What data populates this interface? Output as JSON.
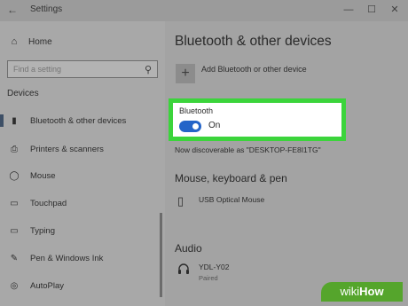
{
  "window": {
    "title": "Settings",
    "back_glyph": "←",
    "controls": {
      "minimize": "—",
      "maximize": "☐",
      "close": "✕"
    }
  },
  "sidebar": {
    "home_label": "Home",
    "search_placeholder": "Find a setting",
    "section_title": "Devices",
    "items": [
      {
        "label": "Bluetooth & other devices",
        "icon": "bluetooth-icon",
        "glyph": "▮",
        "active": true
      },
      {
        "label": "Printers & scanners",
        "icon": "printer-icon",
        "glyph": "⎙"
      },
      {
        "label": "Mouse",
        "icon": "mouse-icon",
        "glyph": "◯"
      },
      {
        "label": "Touchpad",
        "icon": "touchpad-icon",
        "glyph": "▭"
      },
      {
        "label": "Typing",
        "icon": "keyboard-icon",
        "glyph": "▭"
      },
      {
        "label": "Pen & Windows Ink",
        "icon": "pen-icon",
        "glyph": "✎"
      },
      {
        "label": "AutoPlay",
        "icon": "autoplay-icon",
        "glyph": "◎"
      }
    ]
  },
  "main": {
    "title": "Bluetooth & other devices",
    "add_device_label": "Add Bluetooth or other device",
    "add_glyph": "+",
    "bluetooth": {
      "label": "Bluetooth",
      "state_text": "On",
      "enabled": true
    },
    "discoverable_text": "Now discoverable as \"DESKTOP-FE8I1TG\"",
    "mouse_section": {
      "title": "Mouse, keyboard & pen",
      "device": {
        "name": "USB Optical Mouse",
        "icon": "mouse-icon",
        "glyph": "▯"
      }
    },
    "audio_section": {
      "title": "Audio",
      "device": {
        "name": "YDL-Y02",
        "status": "Paired",
        "icon": "headset-icon",
        "glyph": "🎧"
      }
    }
  },
  "watermark": {
    "prefix": "wiki",
    "suffix": "How"
  },
  "colors": {
    "highlight": "#3bd43b",
    "toggle_on": "#2464c8",
    "watermark": "#55a52c"
  }
}
